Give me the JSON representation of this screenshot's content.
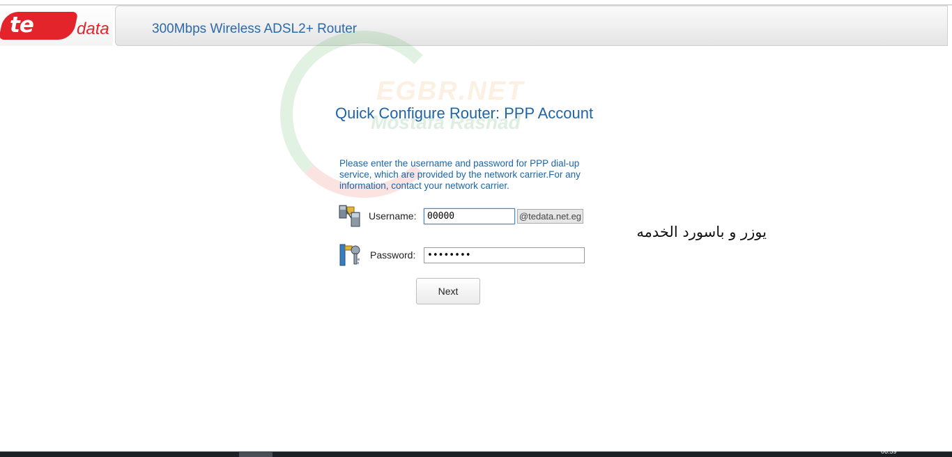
{
  "header": {
    "logo_te": "te",
    "logo_data": "data",
    "title": "300Mbps Wireless ADSL2+ Router"
  },
  "watermark": {
    "site": "EGBR.NET",
    "author": "Mostafa Rashad"
  },
  "main": {
    "title": "Quick Configure Router: PPP Account",
    "instructions": "Please enter the username and password for PPP dial-up service, which are provided by the network carrier.For any information, contact your network carrier.",
    "username": {
      "label": "Username:",
      "value": "00000",
      "suffix": "@tedata.net.eg"
    },
    "password": {
      "label": "Password:",
      "value": "12345678"
    },
    "next_label": "Next"
  },
  "annotation": {
    "arabic_note": "يوزر و باسورد الخدمه"
  },
  "taskbar": {
    "clock": "06:59"
  },
  "colors": {
    "brand_red": "#e3242b",
    "title_blue": "#1f64a3",
    "header_blue": "#2b6aa8"
  }
}
